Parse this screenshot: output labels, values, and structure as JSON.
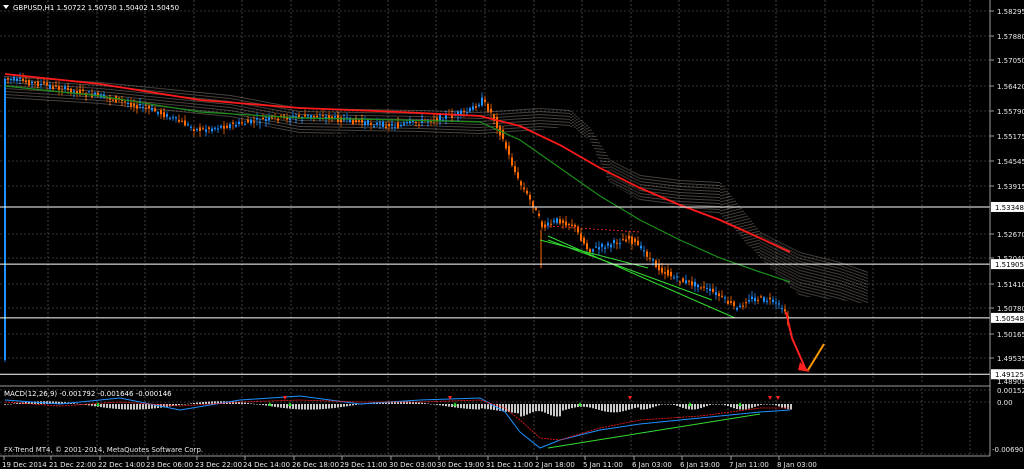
{
  "header": {
    "symbol_info": "GBPUSD,H1  1.50722 1.50730 1.50402 1.50450",
    "dropdown_icon": "triangle-down-icon"
  },
  "price_axis": {
    "ticks": [
      "1.58295",
      "1.57880",
      "1.57050",
      "1.56420",
      "1.55790",
      "1.55175",
      "1.54545",
      "1.53915",
      "1.52670",
      "1.52040",
      "1.51410",
      "1.50780",
      "1.50165",
      "1.49535"
    ],
    "markers": [
      {
        "label": "1.53348",
        "price": 1.53348
      },
      {
        "label": "1.51905",
        "price": 1.51905
      },
      {
        "label": "1.50548",
        "price": 1.50548
      },
      {
        "label": "1.49125",
        "price": 1.49125
      }
    ],
    "range": [
      1.4905,
      1.5855
    ],
    "arrow_labels": [
      "1.48905"
    ]
  },
  "macd": {
    "title": "MACD(12,26,9) -0.001792 -0.001646 -0.000146",
    "ticks": [
      "0.00152",
      "0.00"
    ],
    "bottom_tick": "-0.00690"
  },
  "time_axis": {
    "labels": [
      "19 Dec 2014",
      "21 Dec 22:00",
      "22 Dec 14:00",
      "23 Dec 06:00",
      "23 Dec 22:00",
      "24 Dec 14:00",
      "26 Dec 18:00",
      "29 Dec 11:00",
      "30 Dec 03:00",
      "30 Dec 19:00",
      "31 Dec 11:00",
      "2 Jan 18:00",
      "5 Jan 11:00",
      "6 Jan 03:00",
      "6 Jan 19:00",
      "7 Jan 11:00",
      "8 Jan 03:00"
    ]
  },
  "footer": {
    "copyright": "FX-Trend MT4, © 2001-2014, MetaQuotes Software Corp."
  },
  "colors": {
    "background": "#000000",
    "grid": "#6a6a6a",
    "candle_up": "#1e90ff",
    "candle_down": "#ff6a00",
    "ma_fast": "#ff1a1a",
    "ma_slow": "#1a8f1a",
    "ichimoku_cloud": "#e8d8c8",
    "hline": "#ffffff",
    "arrow_down": "#ff2020",
    "arrow_up": "#ff9900",
    "macd_hist": "#c8c8c8",
    "macd_line": "#1e90ff",
    "signal_line": "#ff1a1a",
    "trend_green": "#33dd33"
  }
}
